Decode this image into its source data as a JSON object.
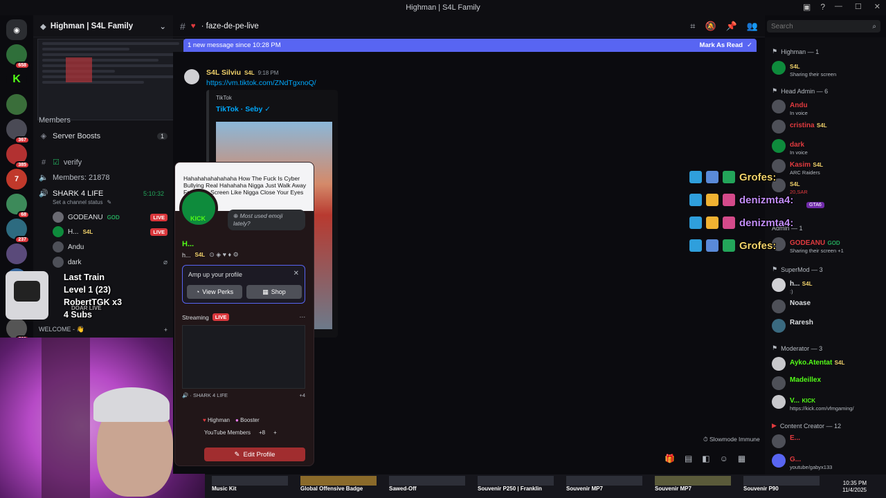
{
  "window": {
    "title": "Highman | S4L Family"
  },
  "rail": {
    "badges": [
      "658",
      "367",
      "385",
      "68",
      "237",
      "211"
    ]
  },
  "sidebar": {
    "server_name": "Highman | S4L Family",
    "members_cat": "Members",
    "server_boosts": "Server Boosts",
    "server_boosts_count": "1",
    "channels": {
      "verify": "verify",
      "members": "Members: 21878",
      "voice": "SHARK 4 LIFE",
      "voice_time": "5:10:32",
      "voice_status": "Set a channel status",
      "welcome": "WELCOME - 👋"
    },
    "voice_users": [
      {
        "name": "GODEANU",
        "tag": "GOD",
        "live": "LIVE"
      },
      {
        "name": "H...",
        "tag": "S4L",
        "live": "LIVE"
      },
      {
        "name": "Andu"
      },
      {
        "name": "dark"
      }
    ]
  },
  "overlay_widget": {
    "line1": "Last Train",
    "line2": "Level 1 (23)",
    "line3": "RobertTGK x3",
    "line4": "4 Subs",
    "sub": "DOAR LIVE"
  },
  "channel": {
    "name": "faze-de-pe-live",
    "new_messages": "1 new message since 10:28 PM",
    "mark_read": "Mark As Read",
    "search_placeholder": "Search"
  },
  "message": {
    "author": "S4L Silviu",
    "tag": "S4L",
    "time": "9:18 PM",
    "link": "https://vm.tiktok.com/ZNdTgxnoQ/",
    "embed_provider": "TikTok",
    "embed_title": "TikTok · Seby ✓"
  },
  "profile": {
    "tweet": "Hahahahahahahaha How The Fuck Is Cyber Bullying Real Hahahaha Nigga Just Walk Away From The Screen Like Nigga Close Your Eyes",
    "bubble": "Most used emoji lately?",
    "name": "H...",
    "nick": "h...",
    "nick_tag": "S4L",
    "amp_title": "Amp up your profile",
    "view_perks": "View Perks",
    "shop": "Shop",
    "streaming": "Streaming",
    "live": "LIVE",
    "stream_channel": "SHARK 4 LIFE",
    "stream_count": "+4",
    "role1": "Highman",
    "role2": "Booster",
    "role3": "YouTube Members",
    "role_more": "+8",
    "edit_profile": "Edit Profile"
  },
  "slowmode": "Slowmode Immune",
  "members": {
    "groups": [
      {
        "title": "Highman — 1"
      },
      {
        "title": "Head Admin — 6"
      },
      {
        "title": "SuperMod — 3"
      },
      {
        "title": "Moderator — 3"
      },
      {
        "title": "Content Creator — 12"
      }
    ],
    "rows": [
      {
        "name": "",
        "tag": "S4L",
        "status": "Sharing their screen",
        "color": "#53fc18"
      },
      {
        "name": "Andu",
        "tag": "",
        "status": "In voice",
        "color": "#e03a3e"
      },
      {
        "name": "cristina",
        "tag": "S4L",
        "status": "",
        "color": "#e03a3e"
      },
      {
        "name": "dark",
        "tag": "",
        "status": "In voice",
        "color": "#e03a3e"
      },
      {
        "name": "Kasim",
        "tag": "S4L",
        "status": "ARC Raiders",
        "color": "#e03a3e"
      },
      {
        "name": "",
        "tag": "S4L",
        "status": "",
        "color": "#e03a3e"
      },
      {
        "name": "GODEANU",
        "tag": "GOD",
        "status": "Sharing their screen +1",
        "color": "#e03a3e"
      },
      {
        "name": "h...",
        "tag": "S4L",
        "status": ":)",
        "color": "#dbdee1"
      },
      {
        "name": "Noase",
        "tag": "",
        "status": "",
        "color": "#dbdee1"
      },
      {
        "name": "Raresh",
        "tag": "",
        "status": "",
        "color": "#dbdee1"
      },
      {
        "name": "Ayko.Atentat",
        "tag": "S4L",
        "status": "",
        "color": "#53fc18"
      },
      {
        "name": "Madeillex",
        "tag": "",
        "status": "",
        "color": "#53fc18"
      },
      {
        "name": "V...",
        "tag": "KICK",
        "status": "https://kick.com/vfmgaming/",
        "color": "#53fc18"
      },
      {
        "name": "E...",
        "tag": "",
        "status": "",
        "color": "#e03a3e"
      },
      {
        "name": "G...",
        "tag": "",
        "status": "youtube/gabyx133",
        "color": "#e03a3e"
      }
    ],
    "admin_label": "Admin — 1",
    "sar_label": "20,SAR",
    "gta_label": "GTA6"
  },
  "chat_overlay": [
    {
      "name": "Grofes:",
      "color": "#f0d16a"
    },
    {
      "name": "denizmta4:",
      "color": "#c08cf5"
    },
    {
      "name": "denizmta4:",
      "color": "#c08cf5"
    },
    {
      "name": "Grofes:",
      "color": "#f0d16a"
    }
  ],
  "taskbar": {
    "items": [
      "Music Kit",
      "Global Offensive Badge",
      "Sawed-Off",
      "Souvenir P250 | Franklin",
      "Souvenir MP7",
      "Souvenir MP7",
      "Souvenir P90"
    ],
    "time": "10:35 PM",
    "date": "11/4/2025"
  }
}
